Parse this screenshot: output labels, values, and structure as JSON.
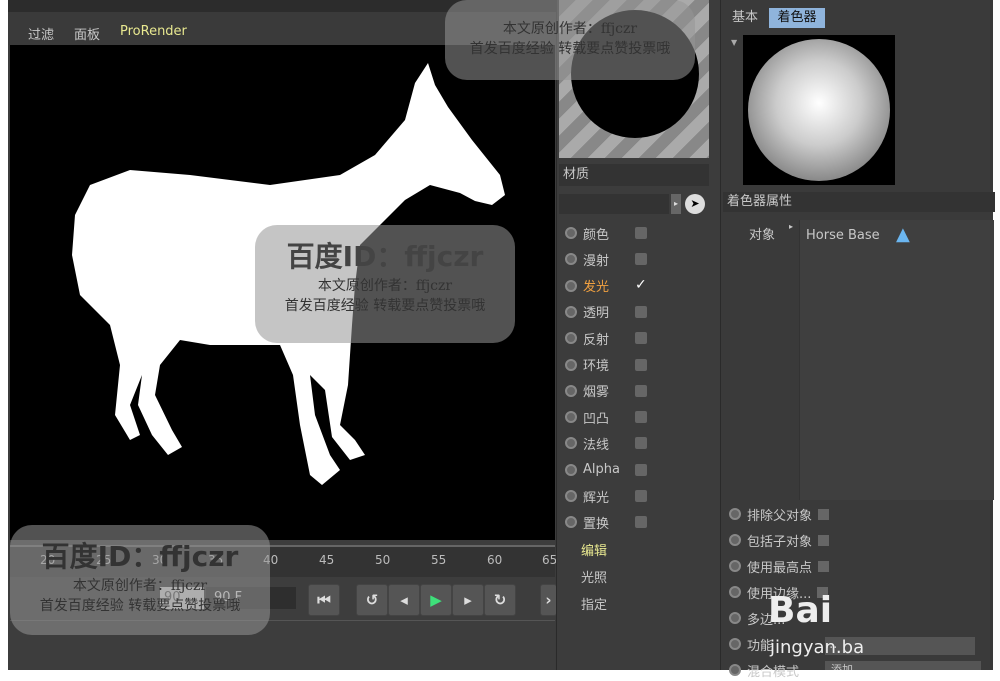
{
  "menu": {
    "items": [
      "过滤",
      "面板",
      "ProRender"
    ]
  },
  "timeline": {
    "ticks": [
      "20",
      "25",
      "30",
      "35",
      "40",
      "45",
      "50",
      "55",
      "60",
      "65"
    ],
    "end_frame": "90 F",
    "start_frame": "90"
  },
  "material": {
    "label": "材质",
    "channels": [
      {
        "label": "颜色",
        "checked": false
      },
      {
        "label": "漫射",
        "checked": false
      },
      {
        "label": "发光",
        "checked": true,
        "active": true
      },
      {
        "label": "透明",
        "checked": false
      },
      {
        "label": "反射",
        "checked": false
      },
      {
        "label": "环境",
        "checked": false
      },
      {
        "label": "烟雾",
        "checked": false
      },
      {
        "label": "凹凸",
        "checked": false
      },
      {
        "label": "法线",
        "checked": false
      },
      {
        "label": "Alpha",
        "checked": false
      },
      {
        "label": "辉光",
        "checked": false
      },
      {
        "label": "置换",
        "checked": false
      }
    ],
    "sections": [
      "编辑",
      "光照",
      "指定"
    ]
  },
  "right": {
    "tabs": [
      "基本",
      "着色器"
    ],
    "header": "着色器属性",
    "object_label": "对象",
    "object_value": "Horse Base",
    "options": [
      "排除父对象",
      "包括子对象",
      "使用最高点",
      "使用边缘...",
      "多边...",
      "功能",
      "混合模式"
    ],
    "dropdown1": "...",
    "dropdown2": "添加"
  },
  "watermark": {
    "id": "百度ID：ffjczr",
    "line1": "本文原创作者：ffjczr",
    "line2": "首发百度经验  转载要点赞投票哦",
    "baidu": "Bai",
    "site": "jingyan.ba"
  }
}
